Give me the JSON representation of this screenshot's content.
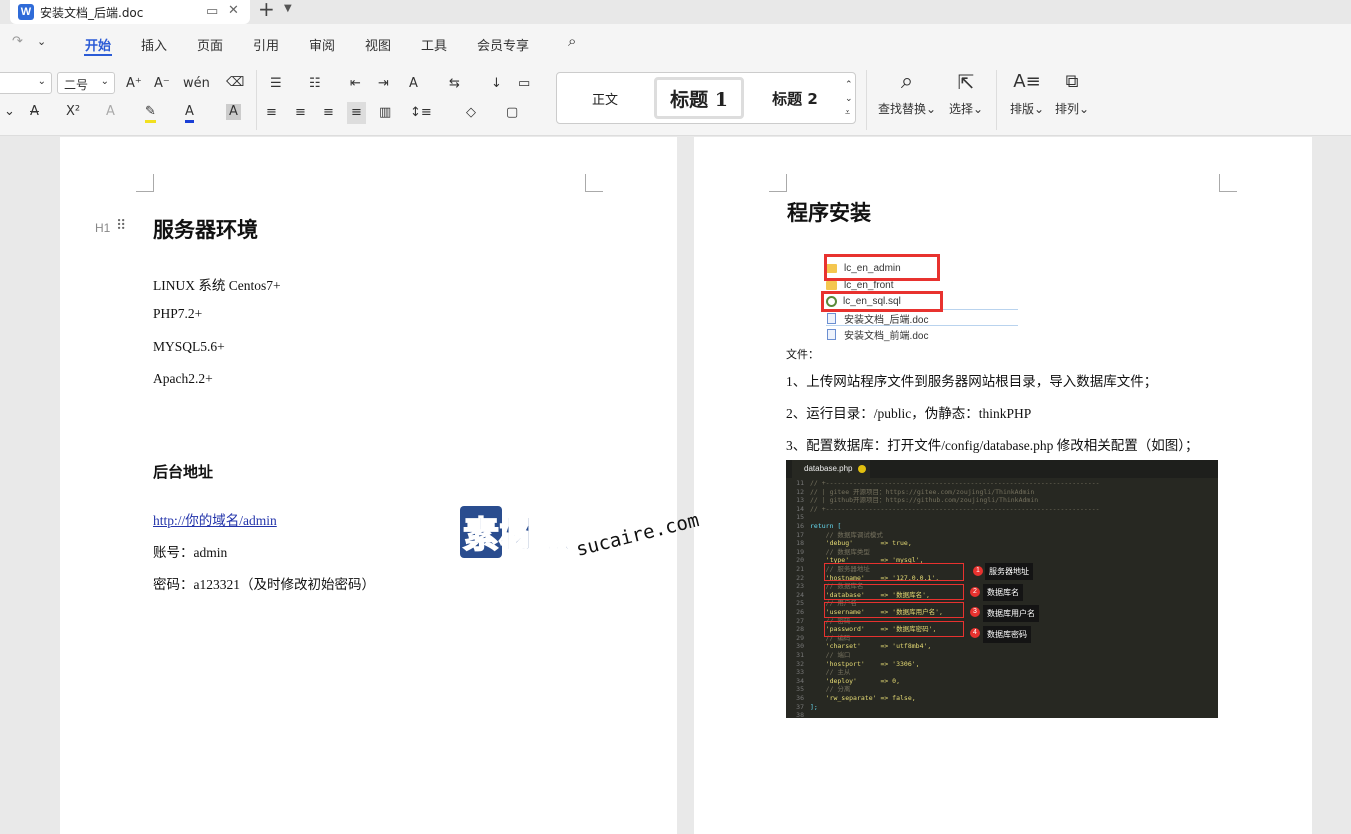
{
  "window": {
    "doc_tab_title": "安装文档_后端.doc",
    "app_icon": "W"
  },
  "menu": {
    "items": [
      "开始",
      "插入",
      "页面",
      "引用",
      "审阅",
      "视图",
      "工具",
      "会员专享"
    ],
    "active": "开始"
  },
  "ribbon": {
    "font_size": "二号",
    "styles": [
      "正文",
      "标题 1",
      "标题 2"
    ],
    "find_replace": "查找替换",
    "select": "选择",
    "layout": "排版",
    "arrange": "排列"
  },
  "left_page": {
    "heading": "服务器环境",
    "heading_marker": "H1",
    "env_lines": [
      "LINUX 系统  Centos7+",
      "PHP7.2+",
      "MYSQL5.6+",
      "Apach2.2+"
    ],
    "admin_heading": "后台地址",
    "admin_url": "http://你的域名/admin",
    "account": "账号：admin",
    "password": "密码：a123321（及时修改初始密码）"
  },
  "right_page": {
    "heading": "程序安装",
    "files": [
      "lc_en_admin",
      "lc_en_front",
      "lc_en_sql.sql",
      "安装文档_后端.doc",
      "安装文档_前端.doc"
    ],
    "caption": "文件：",
    "steps": [
      "1、上传网站程序文件到服务器网站根目录，导入数据库文件；",
      "2、运行目录：/public，伪静态：thinkPHP",
      "3、配置数据库：打开文件/config/database.php 修改相关配置（如图）；"
    ],
    "code_tab": "database.php",
    "code_callouts": [
      "服务器地址",
      "数据库名",
      "数据库用户名",
      "数据库密码"
    ],
    "code_lines": [
      [
        "11",
        "// +----------------------------------------------------------------------"
      ],
      [
        "12",
        "// | gitee 开源项目：https://gitee.com/zoujingli/ThinkAdmin"
      ],
      [
        "13",
        "// | github开源项目：https://github.com/zoujingli/ThinkAdmin"
      ],
      [
        "14",
        "// +----------------------------------------------------------------------"
      ],
      [
        "15",
        ""
      ],
      [
        "16",
        "return ["
      ],
      [
        "17",
        "    // 数据库调试模式"
      ],
      [
        "18",
        "    'debug'       => true,"
      ],
      [
        "19",
        "    // 数据库类型"
      ],
      [
        "20",
        "    'type'        => 'mysql',"
      ],
      [
        "21",
        "    // 服务器地址"
      ],
      [
        "22",
        "    'hostname'    => '127.0.0.1',"
      ],
      [
        "23",
        "    // 数据库名"
      ],
      [
        "24",
        "    'database'    => '数据库名',"
      ],
      [
        "25",
        "    // 用户名"
      ],
      [
        "26",
        "    'username'    => '数据库用户名',"
      ],
      [
        "27",
        "    // 密码"
      ],
      [
        "28",
        "    'password'    => '数据库密码',"
      ],
      [
        "29",
        "    // 编码"
      ],
      [
        "30",
        "    'charset'     => 'utf8mb4',"
      ],
      [
        "31",
        "    // 端口"
      ],
      [
        "32",
        "    'hostport'    => '3306',"
      ],
      [
        "33",
        "    // 主从"
      ],
      [
        "34",
        "    'deploy'      => 0,"
      ],
      [
        "35",
        "    // 分离"
      ],
      [
        "36",
        "    'rw_separate' => false,"
      ],
      [
        "37",
        "];"
      ],
      [
        "38",
        ""
      ]
    ]
  },
  "watermark": {
    "brand": "素材熱",
    "domain": "sucaire.com"
  }
}
